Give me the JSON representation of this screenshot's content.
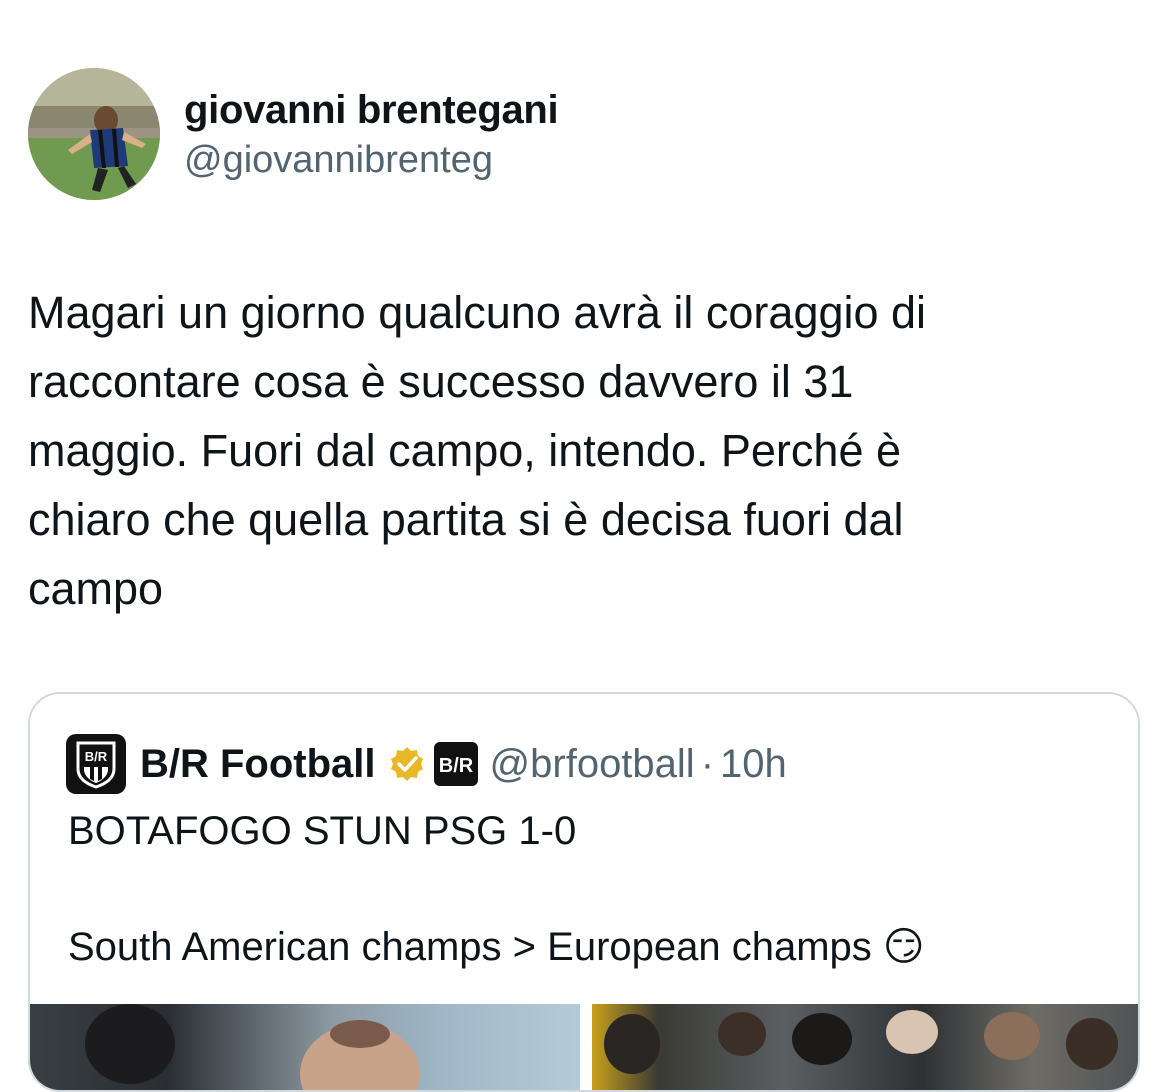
{
  "author": {
    "display_name": "giovanni brentegani",
    "handle": "@giovannibrenteg"
  },
  "tweet": {
    "text": "Magari un giorno qualcuno avrà il coraggio di\nraccontare cosa è successo davvero il 31\nmaggio. Fuori dal campo, intendo. Perché è\nchiaro che quella partita si è decisa fuori dal\ncampo"
  },
  "quoted_tweet": {
    "display_name": "B/R Football",
    "avatar_logo": "B/R",
    "affiliate_badge": "B/R",
    "handle": "@brfootball",
    "separator": "·",
    "time": "10h",
    "text": "BOTAFOGO STUN PSG 1-0\n\nSouth American champs > European champs 😏",
    "verified_icon": "verified-gold-icon"
  },
  "colors": {
    "text_primary": "#0f1419",
    "text_secondary": "#536471",
    "border": "#cfd9de",
    "verified_gold": "#e8b829"
  }
}
